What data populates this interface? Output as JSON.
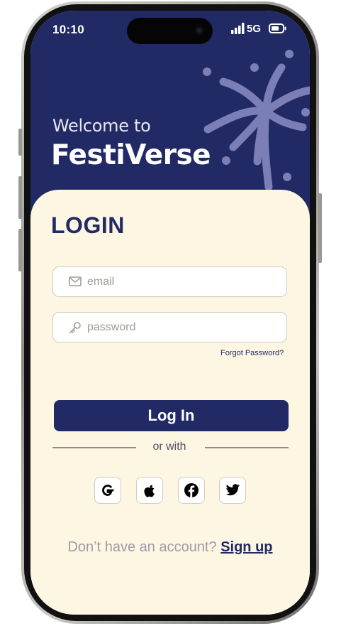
{
  "status_bar": {
    "time": "10:10",
    "network": "5G"
  },
  "hero": {
    "welcome": "Welcome to",
    "brand": "FestiVerse"
  },
  "login": {
    "title": "LOGIN",
    "email_placeholder": "email",
    "password_placeholder": "password",
    "forgot_label": "Forgot Password?",
    "submit_label": "Log In",
    "divider_text": "or with"
  },
  "social": [
    {
      "icon": "google-icon"
    },
    {
      "icon": "apple-icon"
    },
    {
      "icon": "facebook-icon"
    },
    {
      "icon": "twitter-icon"
    }
  ],
  "signup": {
    "prompt": "Don’t have an account?",
    "link": "Sign up"
  },
  "colors": {
    "primary": "#222a66",
    "background": "#fdf6e3",
    "muted": "#a09aa6"
  }
}
